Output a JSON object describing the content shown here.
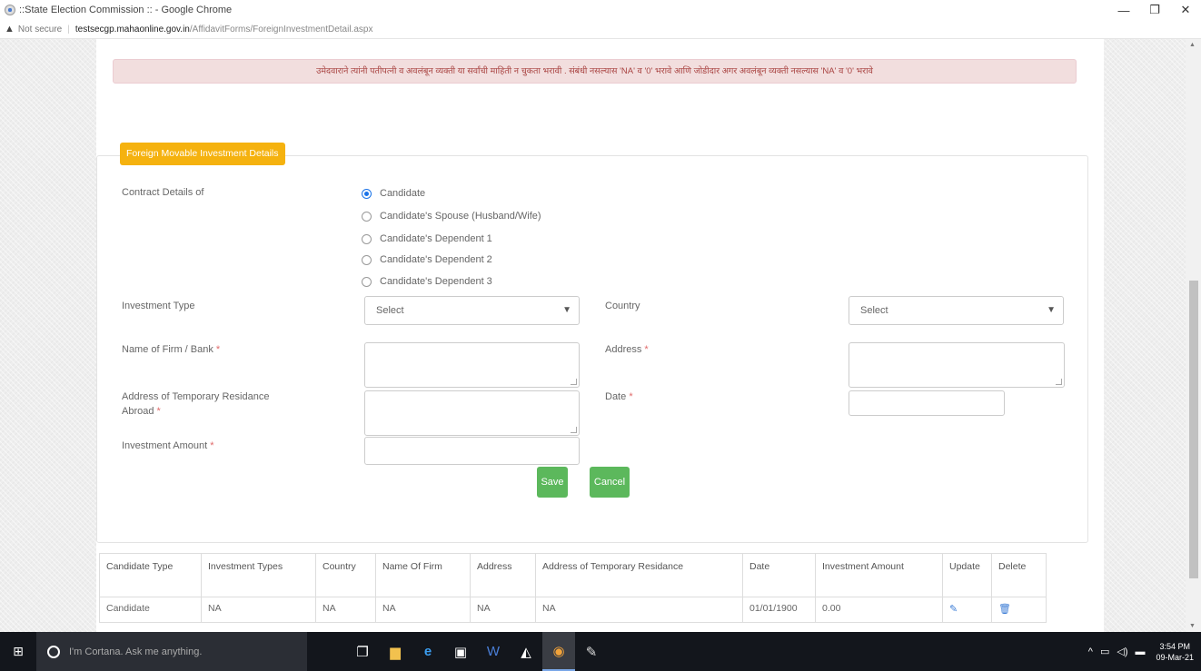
{
  "browser": {
    "window_title": "::State Election Commission :: - Google Chrome",
    "not_secure": "Not secure",
    "url_host": "testsecgp.mahaonline.gov.in",
    "url_path": "/AffidavitForms/ForeignInvestmentDetail.aspx",
    "controls": {
      "minimize": "—",
      "restore": "❐",
      "close": "✕"
    }
  },
  "alert_text": "उमेदवाराने त्यांनी पतीपत्नी व अवलंबून व्यक्ती या सर्वांची माहिती न चुकता भरावी . संबंधी नसल्यास 'NA' व '0' भरावे आणि जोडीदार अगर अवलंबून व्यक्ती नसल्यास 'NA' व '0' भरावे",
  "form": {
    "legend": "Foreign Movable Investment Details",
    "contract_label": "Contract Details of",
    "radio_options": [
      {
        "label": "Candidate",
        "checked": true
      },
      {
        "label": "Candidate's Spouse (Husband/Wife)",
        "checked": false
      },
      {
        "label": "Candidate's Dependent 1",
        "checked": false
      },
      {
        "label": "Candidate's Dependent 2",
        "checked": false
      },
      {
        "label": "Candidate's Dependent 3",
        "checked": false
      }
    ],
    "investment_type_label": "Investment Type",
    "investment_type_value": "Select",
    "country_label": "Country",
    "country_value": "Select",
    "firm_label": "Name of Firm / Bank",
    "address_label": "Address",
    "temp_address_label_1": "Address of Temporary Residance",
    "temp_address_label_2": "Abroad",
    "date_label": "Date",
    "amount_label": "Investment Amount",
    "required_mark": "*",
    "save_label": "Save",
    "cancel_label": "Cancel",
    "colors": {
      "save": "#5cb85c",
      "cancel": "#5cb85c",
      "legend": "#f5b20f"
    }
  },
  "table": {
    "headers": [
      "Candidate Type",
      "Investment Types",
      "Country",
      "Name Of Firm",
      "Address",
      "Address of Temporary Residance",
      "Date",
      "Investment Amount",
      "Update",
      "Delete"
    ],
    "rows": [
      {
        "candidate_type": "Candidate",
        "investment_types": "NA",
        "country": "NA",
        "name_of_firm": "NA",
        "address": "NA",
        "temp_address": "NA",
        "date": "01/01/1900",
        "amount": "0.00",
        "update_icon": "edit-icon",
        "delete_icon": "trash-icon"
      }
    ]
  },
  "taskbar": {
    "cortana_placeholder": "I'm Cortana. Ask me anything.",
    "time": "3:54 PM",
    "date": "09-Mar-21",
    "apps": [
      "task-view-icon",
      "file-explorer-icon",
      "edge-icon",
      "store-icon",
      "word-icon",
      "photos-icon",
      "chrome-icon",
      "paint-icon"
    ]
  }
}
